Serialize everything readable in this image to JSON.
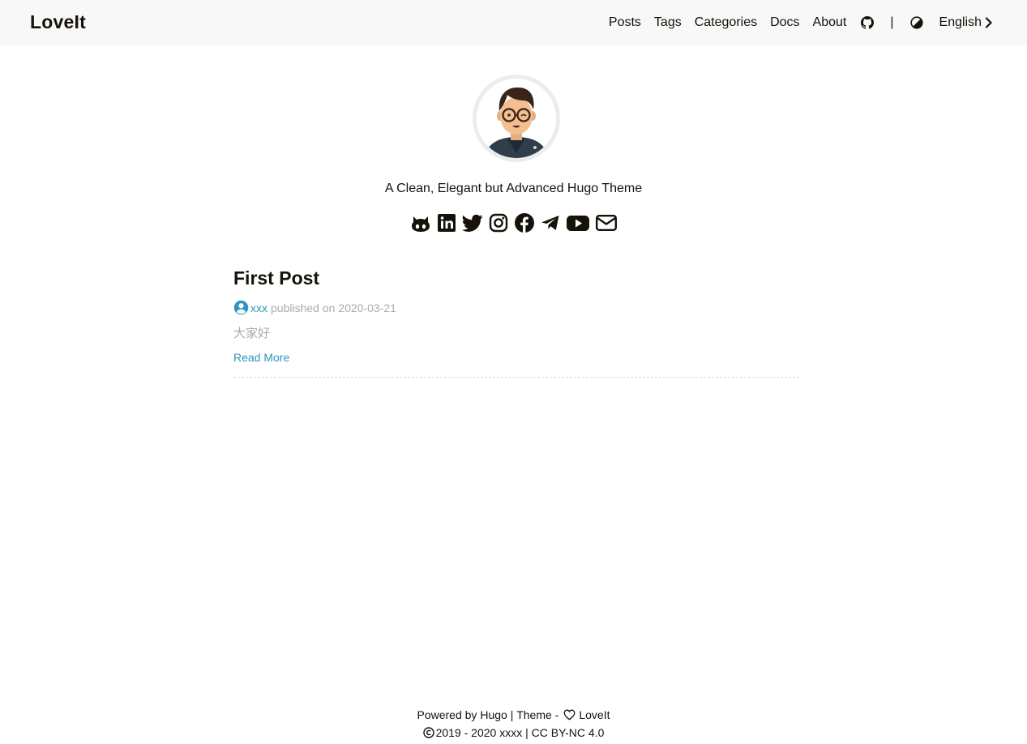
{
  "site": {
    "logo": "LoveIt"
  },
  "nav": {
    "items": [
      "Posts",
      "Tags",
      "Categories",
      "Docs",
      "About"
    ],
    "github_icon": "github-icon",
    "separator": "|",
    "theme_icon": "half-circle-contrast-icon",
    "language": "English",
    "language_icon": "chevron-right-icon"
  },
  "profile": {
    "avatar_icon": "cartoon-avatar-with-glasses",
    "subtitle": "A Clean, Elegant but Advanced Hugo Theme",
    "social_icons": [
      "github-icon",
      "linkedin-icon",
      "twitter-icon",
      "instagram-icon",
      "facebook-icon",
      "telegram-icon",
      "youtube-icon",
      "email-icon"
    ]
  },
  "post": {
    "title": "First Post",
    "author": "xxx",
    "meta": "published on 2020-03-21",
    "summary": "大家好",
    "read_more": "Read More"
  },
  "footer": {
    "powered_by": "Powered by",
    "hugo": "Hugo",
    "separator": "|",
    "theme_label": "Theme -",
    "theme_name": "LoveIt",
    "years": "2019 - 2020",
    "owner": "xxxx",
    "license": "CC BY-NC 4.0"
  },
  "colors": {
    "accent": "#2d96bd",
    "text": "#161209",
    "muted": "#a9a9b3",
    "header_bg": "#f8f8f8"
  }
}
